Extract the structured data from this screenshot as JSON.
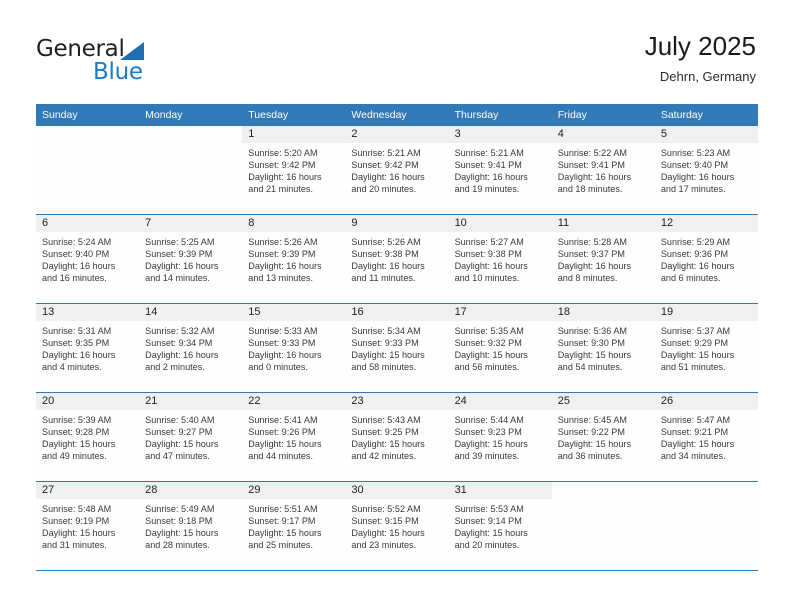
{
  "brand": {
    "name_top": "General",
    "name_bottom": "Blue",
    "accent_color": "#1f7ac4"
  },
  "header": {
    "title": "July 2025",
    "subtitle": "Dehrn, Germany"
  },
  "theme": {
    "header_row_color": "#3279b7",
    "daynum_band_color": "#f0f0f0",
    "week_divider_color": "#3279b7"
  },
  "weekday_headers": [
    "Sunday",
    "Monday",
    "Tuesday",
    "Wednesday",
    "Thursday",
    "Friday",
    "Saturday"
  ],
  "labels": {
    "sunrise_prefix": "Sunrise:",
    "sunset_prefix": "Sunset:",
    "daylight_prefix": "Daylight:"
  },
  "weeks": [
    [
      {
        "day": "",
        "lines": []
      },
      {
        "day": "",
        "lines": []
      },
      {
        "day": "1",
        "lines": [
          "Sunrise: 5:20 AM",
          "Sunset: 9:42 PM",
          "Daylight: 16 hours",
          "and 21 minutes."
        ]
      },
      {
        "day": "2",
        "lines": [
          "Sunrise: 5:21 AM",
          "Sunset: 9:42 PM",
          "Daylight: 16 hours",
          "and 20 minutes."
        ]
      },
      {
        "day": "3",
        "lines": [
          "Sunrise: 5:21 AM",
          "Sunset: 9:41 PM",
          "Daylight: 16 hours",
          "and 19 minutes."
        ]
      },
      {
        "day": "4",
        "lines": [
          "Sunrise: 5:22 AM",
          "Sunset: 9:41 PM",
          "Daylight: 16 hours",
          "and 18 minutes."
        ]
      },
      {
        "day": "5",
        "lines": [
          "Sunrise: 5:23 AM",
          "Sunset: 9:40 PM",
          "Daylight: 16 hours",
          "and 17 minutes."
        ]
      }
    ],
    [
      {
        "day": "6",
        "lines": [
          "Sunrise: 5:24 AM",
          "Sunset: 9:40 PM",
          "Daylight: 16 hours",
          "and 16 minutes."
        ]
      },
      {
        "day": "7",
        "lines": [
          "Sunrise: 5:25 AM",
          "Sunset: 9:39 PM",
          "Daylight: 16 hours",
          "and 14 minutes."
        ]
      },
      {
        "day": "8",
        "lines": [
          "Sunrise: 5:26 AM",
          "Sunset: 9:39 PM",
          "Daylight: 16 hours",
          "and 13 minutes."
        ]
      },
      {
        "day": "9",
        "lines": [
          "Sunrise: 5:26 AM",
          "Sunset: 9:38 PM",
          "Daylight: 16 hours",
          "and 11 minutes."
        ]
      },
      {
        "day": "10",
        "lines": [
          "Sunrise: 5:27 AM",
          "Sunset: 9:38 PM",
          "Daylight: 16 hours",
          "and 10 minutes."
        ]
      },
      {
        "day": "11",
        "lines": [
          "Sunrise: 5:28 AM",
          "Sunset: 9:37 PM",
          "Daylight: 16 hours",
          "and 8 minutes."
        ]
      },
      {
        "day": "12",
        "lines": [
          "Sunrise: 5:29 AM",
          "Sunset: 9:36 PM",
          "Daylight: 16 hours",
          "and 6 minutes."
        ]
      }
    ],
    [
      {
        "day": "13",
        "lines": [
          "Sunrise: 5:31 AM",
          "Sunset: 9:35 PM",
          "Daylight: 16 hours",
          "and 4 minutes."
        ]
      },
      {
        "day": "14",
        "lines": [
          "Sunrise: 5:32 AM",
          "Sunset: 9:34 PM",
          "Daylight: 16 hours",
          "and 2 minutes."
        ]
      },
      {
        "day": "15",
        "lines": [
          "Sunrise: 5:33 AM",
          "Sunset: 9:33 PM",
          "Daylight: 16 hours",
          "and 0 minutes."
        ]
      },
      {
        "day": "16",
        "lines": [
          "Sunrise: 5:34 AM",
          "Sunset: 9:33 PM",
          "Daylight: 15 hours",
          "and 58 minutes."
        ]
      },
      {
        "day": "17",
        "lines": [
          "Sunrise: 5:35 AM",
          "Sunset: 9:32 PM",
          "Daylight: 15 hours",
          "and 56 minutes."
        ]
      },
      {
        "day": "18",
        "lines": [
          "Sunrise: 5:36 AM",
          "Sunset: 9:30 PM",
          "Daylight: 15 hours",
          "and 54 minutes."
        ]
      },
      {
        "day": "19",
        "lines": [
          "Sunrise: 5:37 AM",
          "Sunset: 9:29 PM",
          "Daylight: 15 hours",
          "and 51 minutes."
        ]
      }
    ],
    [
      {
        "day": "20",
        "lines": [
          "Sunrise: 5:39 AM",
          "Sunset: 9:28 PM",
          "Daylight: 15 hours",
          "and 49 minutes."
        ]
      },
      {
        "day": "21",
        "lines": [
          "Sunrise: 5:40 AM",
          "Sunset: 9:27 PM",
          "Daylight: 15 hours",
          "and 47 minutes."
        ]
      },
      {
        "day": "22",
        "lines": [
          "Sunrise: 5:41 AM",
          "Sunset: 9:26 PM",
          "Daylight: 15 hours",
          "and 44 minutes."
        ]
      },
      {
        "day": "23",
        "lines": [
          "Sunrise: 5:43 AM",
          "Sunset: 9:25 PM",
          "Daylight: 15 hours",
          "and 42 minutes."
        ]
      },
      {
        "day": "24",
        "lines": [
          "Sunrise: 5:44 AM",
          "Sunset: 9:23 PM",
          "Daylight: 15 hours",
          "and 39 minutes."
        ]
      },
      {
        "day": "25",
        "lines": [
          "Sunrise: 5:45 AM",
          "Sunset: 9:22 PM",
          "Daylight: 15 hours",
          "and 36 minutes."
        ]
      },
      {
        "day": "26",
        "lines": [
          "Sunrise: 5:47 AM",
          "Sunset: 9:21 PM",
          "Daylight: 15 hours",
          "and 34 minutes."
        ]
      }
    ],
    [
      {
        "day": "27",
        "lines": [
          "Sunrise: 5:48 AM",
          "Sunset: 9:19 PM",
          "Daylight: 15 hours",
          "and 31 minutes."
        ]
      },
      {
        "day": "28",
        "lines": [
          "Sunrise: 5:49 AM",
          "Sunset: 9:18 PM",
          "Daylight: 15 hours",
          "and 28 minutes."
        ]
      },
      {
        "day": "29",
        "lines": [
          "Sunrise: 5:51 AM",
          "Sunset: 9:17 PM",
          "Daylight: 15 hours",
          "and 25 minutes."
        ]
      },
      {
        "day": "30",
        "lines": [
          "Sunrise: 5:52 AM",
          "Sunset: 9:15 PM",
          "Daylight: 15 hours",
          "and 23 minutes."
        ]
      },
      {
        "day": "31",
        "lines": [
          "Sunrise: 5:53 AM",
          "Sunset: 9:14 PM",
          "Daylight: 15 hours",
          "and 20 minutes."
        ]
      },
      {
        "day": "",
        "lines": []
      },
      {
        "day": "",
        "lines": []
      }
    ]
  ]
}
